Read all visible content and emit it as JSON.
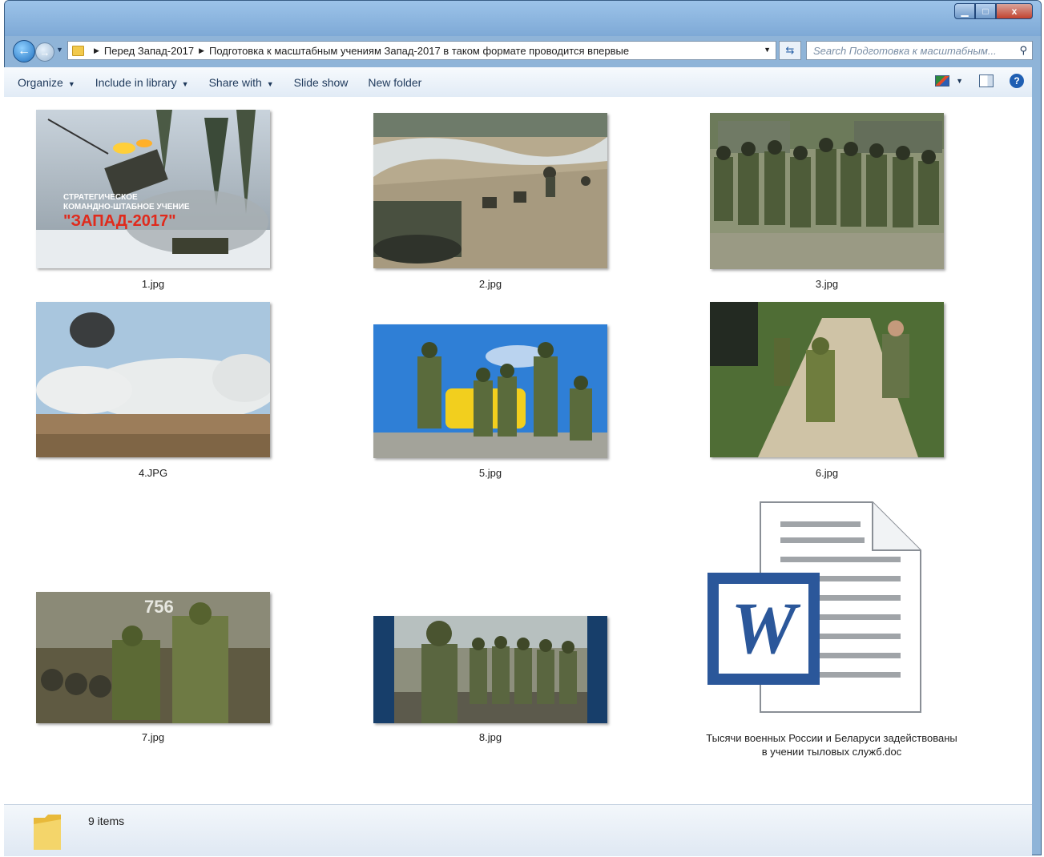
{
  "window": {
    "caption_buttons": {
      "minimize": "▁",
      "maximize": "□",
      "close": "x"
    }
  },
  "address": {
    "back_icon": "back-arrow-icon",
    "crumbs": [
      "Перед Запад-2017",
      "Подготовка  к масштабным учениям Запад-2017 в таком формате проводится впервые"
    ],
    "search_placeholder": "Search Подготовка  к масштабным..."
  },
  "toolbar": {
    "organize": "Organize",
    "include_in_library": "Include in library",
    "share_with": "Share with",
    "slide_show": "Slide show",
    "new_folder": "New folder"
  },
  "files": [
    {
      "name": "1.jpg",
      "overlay_lines": [
        "СТРАТЕГИЧЕСКОЕ",
        "КОМАНДНО-ШТАБНОЕ УЧЕНИЕ"
      ],
      "overlay_title": "\"ЗАПАД-2017\""
    },
    {
      "name": "2.jpg"
    },
    {
      "name": "3.jpg"
    },
    {
      "name": "4.JPG"
    },
    {
      "name": "5.jpg"
    },
    {
      "name": "6.jpg"
    },
    {
      "name": "7.jpg",
      "overlay_number": "756"
    },
    {
      "name": "8.jpg"
    },
    {
      "name": "Тысячи военных России и Беларуси задействованы в учении тыловых служб.doc"
    }
  ],
  "status": {
    "items_count": "9 items"
  },
  "colors": {
    "window_frame": "#8fb4d8",
    "word_blue": "#2b579a",
    "toolbar_text": "#1e395b"
  }
}
